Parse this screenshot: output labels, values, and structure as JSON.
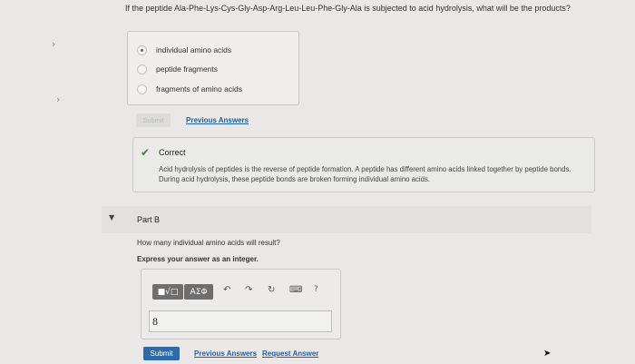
{
  "part_a": {
    "question": "If the peptide Ala-Phe-Lys-Cys-Gly-Asp-Arg-Leu-Leu-Phe-Gly-Ala is subjected to acid hydrolysis, what will be the products?",
    "options": [
      {
        "label": "individual amino acids",
        "selected": true
      },
      {
        "label": "peptide fragments",
        "selected": false
      },
      {
        "label": "fragments of amino acids",
        "selected": false
      }
    ],
    "submit_label": "Submit",
    "previous_answers_label": "Previous Answers",
    "feedback": {
      "status": "Correct",
      "text": "Acid hydrolysis of peptides is the reverse of peptide formation. A peptide has different amino acids linked together by peptide bonds. During acid hydrolysis, these peptide bonds are broken forming individual amino acids."
    }
  },
  "part_b": {
    "title": "Part B",
    "question": "How many individual amino acids will result?",
    "instruction": "Express your answer as an integer.",
    "toolbar": {
      "templates_label": "■√□",
      "symbols_label": "ΑΣΦ",
      "undo_icon": "↶",
      "redo_icon": "↷",
      "reset_icon": "↻",
      "keyboard_icon": "⌨",
      "help_label": "?"
    },
    "answer_value": "8",
    "submit_label": "Submit",
    "previous_answers_label": "Previous Answers",
    "request_answer_label": "Request Answer"
  },
  "icons": {
    "chevron": "›",
    "caret": "▼",
    "check": "✔",
    "cursor": "➤"
  },
  "colors": {
    "accent": "#2f6aa8",
    "correct": "#3b8b2d",
    "link": "#1f5fa8"
  }
}
